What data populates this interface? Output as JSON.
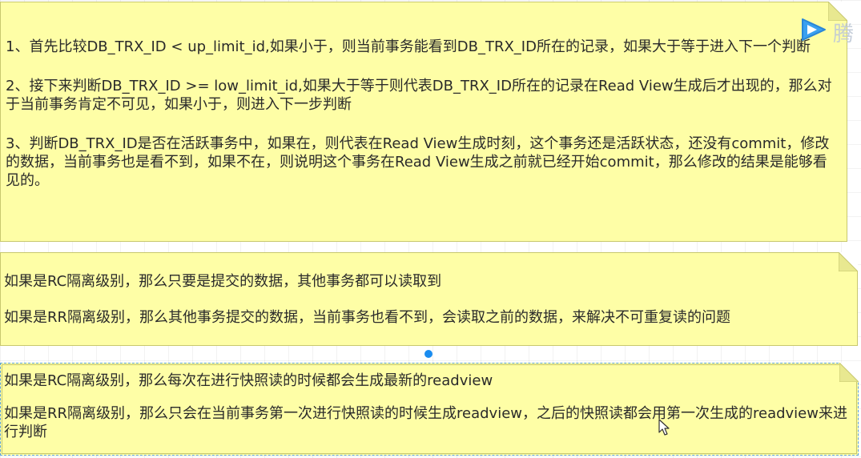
{
  "watermark": {
    "icon": "tencent-video-play-icon",
    "brand_text": "腾"
  },
  "colors": {
    "note_fill": "#fefea6",
    "note_border": "#c8c86e",
    "selection": "#1a8cf0"
  },
  "notes": [
    {
      "paragraphs": [
        " 1、首先比较DB_TRX_ID < up_limit_id,如果小于，则当前事务能看到DB_TRX_ID所在的记录，如果大于等于进入下一个判断",
        " 2、接下来判断DB_TRX_ID >= low_limit_id,如果大于等于则代表DB_TRX_ID所在的记录在Read View生成后才出现的，那么对于当前事务肯定不可见，如果小于，则进入下一步判断",
        " 3、判断DB_TRX_ID是否在活跃事务中，如果在，则代表在Read View生成时刻，这个事务还是活跃状态，还没有commit，修改的数据，当前事务也是看不到，如果不在，则说明这个事务在Read View生成之前就已经开始commit，那么修改的结果是能够看见的。"
      ]
    },
    {
      "paragraphs": [
        "如果是RC隔离级别，那么只要是提交的数据，其他事务都可以读取到",
        "如果是RR隔离级别，那么其他事务提交的数据，当前事务也看不到，会读取之前的数据，来解决不可重复读的问题"
      ]
    },
    {
      "paragraphs": [
        "如果是RC隔离级别，那么每次在进行快照读的时候都会生成最新的readview",
        "如果是RR隔离级别，那么只会在当前事务第一次进行快照读的时候生成readview，之后的快照读都会用第一次生成的readview来进行判断"
      ]
    }
  ]
}
